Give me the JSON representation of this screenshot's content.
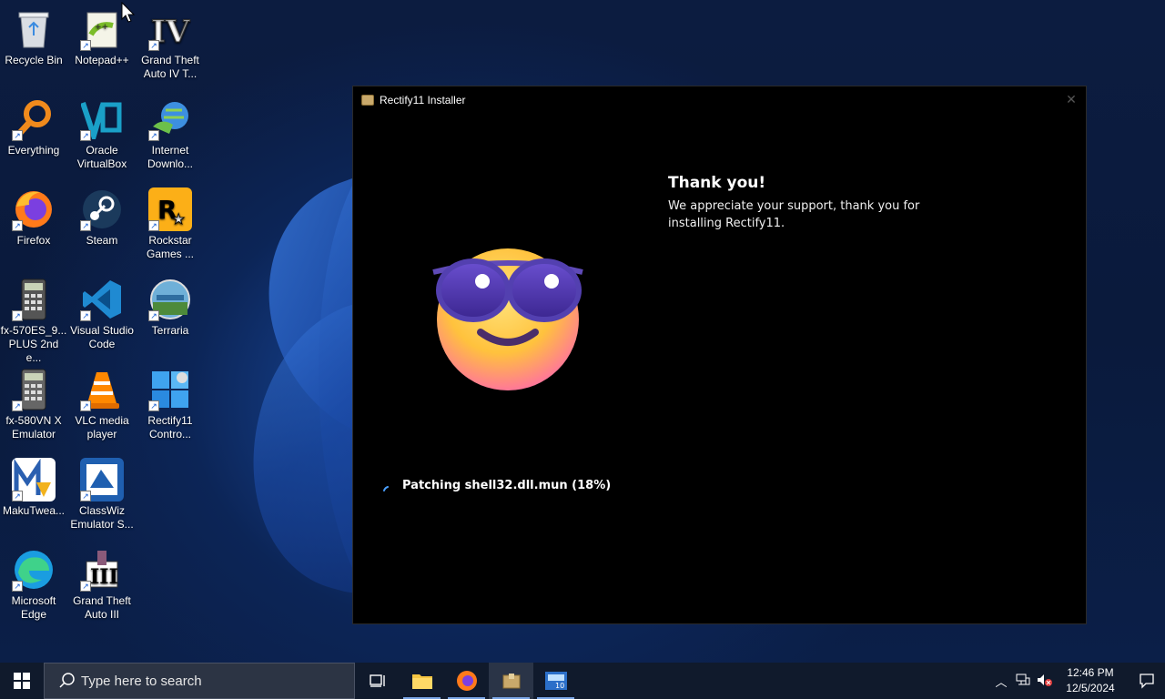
{
  "desktop": {
    "icons": [
      {
        "label": "Recycle Bin",
        "icon": "recycle-bin-icon"
      },
      {
        "label": "Notepad++",
        "icon": "notepad-plus-plus-icon"
      },
      {
        "label": "Grand Theft Auto IV T...",
        "icon": "gta-iv-icon"
      },
      {
        "label": "Everything",
        "icon": "everything-search-icon"
      },
      {
        "label": "Oracle VirtualBox",
        "icon": "virtualbox-icon"
      },
      {
        "label": "Internet Downlo...",
        "icon": "internet-download-manager-icon"
      },
      {
        "label": "Firefox",
        "icon": "firefox-icon"
      },
      {
        "label": "Steam",
        "icon": "steam-icon"
      },
      {
        "label": "Rockstar Games ...",
        "icon": "rockstar-games-icon"
      },
      {
        "label": "fx-570ES_9... PLUS 2nd e...",
        "icon": "calculator-icon"
      },
      {
        "label": "Visual Studio Code",
        "icon": "vscode-icon"
      },
      {
        "label": "Terraria",
        "icon": "terraria-icon"
      },
      {
        "label": "fx-580VN X Emulator",
        "icon": "calculator-icon"
      },
      {
        "label": "VLC media player",
        "icon": "vlc-icon"
      },
      {
        "label": "Rectify11 Contro...",
        "icon": "rectify11-control-icon"
      },
      {
        "label": "MakuTwea...",
        "icon": "makutweaker-icon"
      },
      {
        "label": "ClassWiz Emulator S...",
        "icon": "classwiz-icon"
      },
      {
        "label": "Microsoft Edge",
        "icon": "edge-icon"
      },
      {
        "label": "Grand Theft Auto III",
        "icon": "gta-iii-icon"
      }
    ]
  },
  "installer": {
    "title": "Rectify11 Installer",
    "heading": "Thank you!",
    "message": "We appreciate your support, thank you for installing Rectify11.",
    "status": "Patching shell32.dll.mun (18%)"
  },
  "taskbar": {
    "search_placeholder": "Type here to search",
    "time": "12:46 PM",
    "date": "12/5/2024"
  },
  "colors": {
    "accent": "#7aa6e6",
    "window_bg": "#000000",
    "taskbar_bg": "#101a2c"
  }
}
